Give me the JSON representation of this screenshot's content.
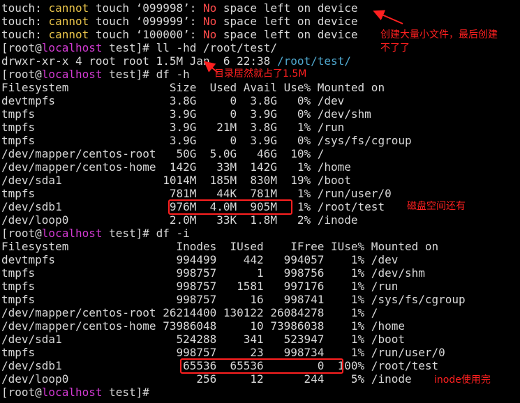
{
  "colors": {
    "background": "#000000",
    "text": "#d8d8d8",
    "warning_yellow": "#e8c34a",
    "error_red": "#ff4b4b",
    "prompt_magenta": "#d23ad2",
    "dir_cyan": "#4fa8cf",
    "annotation_red": "#ff2020"
  },
  "lines": [
    [
      {
        "t": "touch: ",
        "c": "w"
      },
      {
        "t": "cannot",
        "c": "y"
      },
      {
        "t": " touch ‘099998’: ",
        "c": "w"
      },
      {
        "t": "No",
        "c": "r"
      },
      {
        "t": " space left on device",
        "c": "w"
      }
    ],
    [
      {
        "t": "touch: ",
        "c": "w"
      },
      {
        "t": "cannot",
        "c": "y"
      },
      {
        "t": " touch ‘099999’: ",
        "c": "w"
      },
      {
        "t": "No",
        "c": "r"
      },
      {
        "t": " space left on device",
        "c": "w"
      }
    ],
    [
      {
        "t": "touch: ",
        "c": "w"
      },
      {
        "t": "cannot",
        "c": "y"
      },
      {
        "t": " touch ‘100000’: ",
        "c": "w"
      },
      {
        "t": "No",
        "c": "r"
      },
      {
        "t": " space left on device",
        "c": "w"
      }
    ],
    [
      {
        "t": "[root@",
        "c": "w"
      },
      {
        "t": "localhost",
        "c": "m"
      },
      {
        "t": " test]# ll -hd /root/test/",
        "c": "w"
      }
    ],
    [
      {
        "t": "drwxr-xr-x 4 root root 1.5M Jan  6 22:38 ",
        "c": "w"
      },
      {
        "t": "/root/test/",
        "c": "c"
      }
    ],
    [
      {
        "t": "[root@",
        "c": "w"
      },
      {
        "t": "localhost",
        "c": "m"
      },
      {
        "t": " test]# df -h",
        "c": "w"
      }
    ],
    [
      {
        "t": "Filesystem               Size  Used Avail Use% Mounted on",
        "c": "w"
      }
    ],
    [
      {
        "t": "devtmpfs                 3.8G     0  3.8G   0% /dev",
        "c": "w"
      }
    ],
    [
      {
        "t": "tmpfs                    3.9G     0  3.9G   0% /dev/shm",
        "c": "w"
      }
    ],
    [
      {
        "t": "tmpfs                    3.9G   21M  3.8G   1% /run",
        "c": "w"
      }
    ],
    [
      {
        "t": "tmpfs                    3.9G     0  3.9G   0% /sys/fs/cgroup",
        "c": "w"
      }
    ],
    [
      {
        "t": "/dev/mapper/centos-root   50G  5.0G   46G  10% /",
        "c": "w"
      }
    ],
    [
      {
        "t": "/dev/mapper/centos-home  142G   33M  142G   1% /home",
        "c": "w"
      }
    ],
    [
      {
        "t": "/dev/sda1               1014M  185M  830M  19% /boot",
        "c": "w"
      }
    ],
    [
      {
        "t": "tmpfs                    781M   44K  781M   1% /run/user/0",
        "c": "w"
      }
    ],
    [
      {
        "t": "/dev/sdb1                976M  4.0M  905M   1% /root/test",
        "c": "w"
      }
    ],
    [
      {
        "t": "/dev/loop0               2.0M   33K  1.8M   2% /inode",
        "c": "w"
      }
    ],
    [
      {
        "t": "[root@",
        "c": "w"
      },
      {
        "t": "localhost",
        "c": "m"
      },
      {
        "t": " test]# df -i",
        "c": "w"
      }
    ],
    [
      {
        "t": "Filesystem                Inodes  IUsed    IFree IUse% Mounted on",
        "c": "w"
      }
    ],
    [
      {
        "t": "devtmpfs                  994499    442   994057    1% /dev",
        "c": "w"
      }
    ],
    [
      {
        "t": "tmpfs                     998757      1   998756    1% /dev/shm",
        "c": "w"
      }
    ],
    [
      {
        "t": "tmpfs                     998757   1581   997176    1% /run",
        "c": "w"
      }
    ],
    [
      {
        "t": "tmpfs                     998757     16   998741    1% /sys/fs/cgroup",
        "c": "w"
      }
    ],
    [
      {
        "t": "/dev/mapper/centos-root 26214400 130122 26084278    1% /",
        "c": "w"
      }
    ],
    [
      {
        "t": "/dev/mapper/centos-home 73986048     10 73986038    1% /home",
        "c": "w"
      }
    ],
    [
      {
        "t": "/dev/sda1                 524288    341   523947    1% /boot",
        "c": "w"
      }
    ],
    [
      {
        "t": "tmpfs                     998757     23   998734    1% /run/user/0",
        "c": "w"
      }
    ],
    [
      {
        "t": "/dev/sdb1                  65536  65536        0  100% /root/test",
        "c": "w"
      }
    ],
    [
      {
        "t": "/dev/loop0                   256     12      244    5% /inode",
        "c": "w"
      }
    ],
    [
      {
        "t": "[root@",
        "c": "w"
      },
      {
        "t": "localhost",
        "c": "m"
      },
      {
        "t": " test]# ",
        "c": "w"
      }
    ]
  ],
  "annotations": {
    "too_many_files_1": "创建大量小文件，最后创建",
    "too_many_files_2": "不了了",
    "dir_size": "目录居然就占了1.5M",
    "disk_space": "磁盘空间还有",
    "inode_full": "inode使用完"
  }
}
